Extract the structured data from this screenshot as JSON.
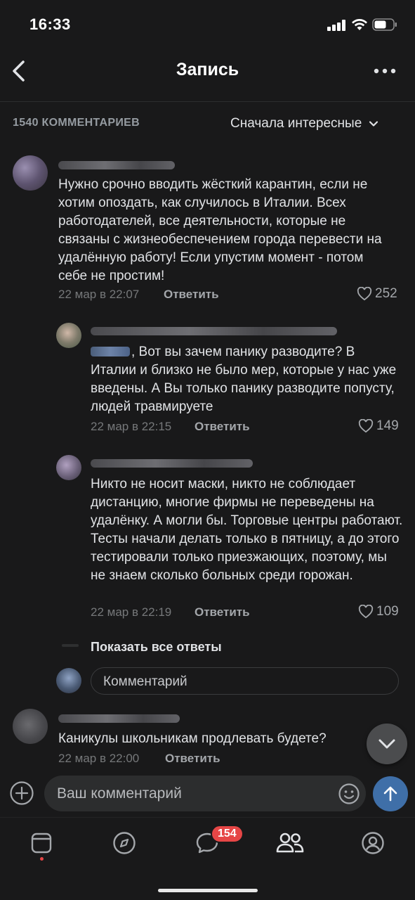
{
  "status_bar": {
    "time": "16:33"
  },
  "nav": {
    "title": "Запись"
  },
  "comments_header": {
    "count": "1540 КОММЕНТАРИЕВ",
    "sort": "Сначала интересные"
  },
  "comments": [
    {
      "text": "Нужно срочно вводить жёсткий карантин, если не хотим опоздать, как случилось в Италии. Всех работодателей, все деятельности, которые не связаны с жизнеобеспечением города перевести на удалённую работу! Если упустим момент - потом себе не простим!",
      "date": "22 мар в 22:07",
      "reply": "Ответить",
      "likes": "252"
    },
    {
      "text": ", Вот вы зачем панику разводите? В Италии и близко не было мер, которые у нас уже введены. А Вы только панику разводите попусту, людей травмируете",
      "date": "22 мар в 22:15",
      "reply": "Ответить",
      "likes": "149"
    },
    {
      "text": "Никто не носит маски, никто не соблюдает дистанцию, многие фирмы не переведены на удалёнку. А могли бы. Торговые центры работают. Тесты начали делать только в пятницу, а до этого тестировали только приезжающих, поэтому, мы не знаем сколько больных среди горожан.",
      "date": "22 мар в 22:19",
      "reply": "Ответить",
      "likes": "109"
    },
    {
      "text": "Каникулы школьникам продлевать будете?",
      "date": "22 мар в 22:00",
      "reply": "Ответить",
      "likes": ""
    }
  ],
  "show_all_replies": "Показать все ответы",
  "reply_input": {
    "placeholder": "Комментарий"
  },
  "composer": {
    "placeholder": "Ваш комментарий"
  },
  "tab_bar": {
    "messages_badge": "154"
  },
  "colors": {
    "accent": "#3f6fa8",
    "badge": "#e64646",
    "background": "#19191a"
  }
}
